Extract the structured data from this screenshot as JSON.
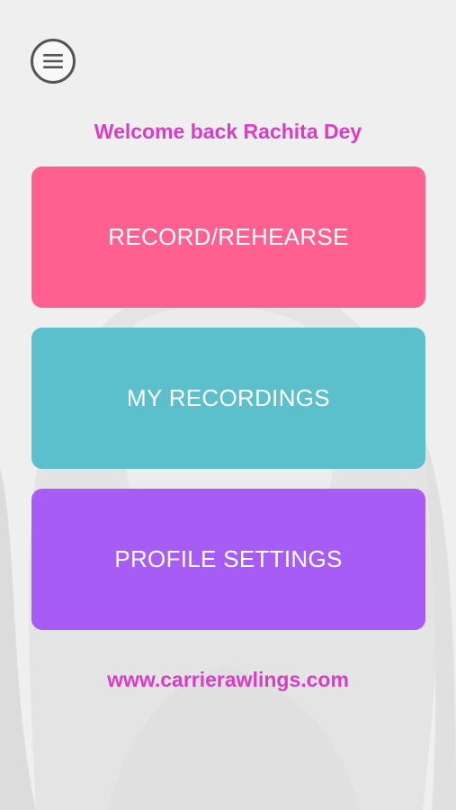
{
  "header": {
    "menu_icon": "hamburger-menu-icon",
    "welcome_text": "Welcome back Rachita Dey"
  },
  "tiles": [
    {
      "label": "RECORD/REHEARSE",
      "color": "#ff6090"
    },
    {
      "label": "MY RECORDINGS",
      "color": "#5bbfcc"
    },
    {
      "label": "PROFILE SETTINGS",
      "color": "#a65cf5"
    }
  ],
  "footer": {
    "website": "www.carrierawlings.com"
  },
  "colors": {
    "accent_text": "#d93cc5",
    "background": "#efefef"
  }
}
